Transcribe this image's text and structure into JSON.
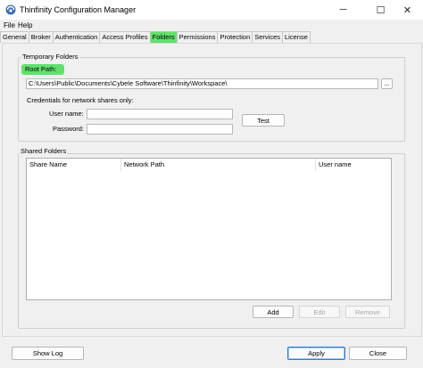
{
  "window": {
    "title": "Thinfinity Configuration Manager",
    "controls": {
      "minimize": "─",
      "maximize": "☐",
      "close": "✕"
    }
  },
  "menu": [
    "File",
    "Help"
  ],
  "tabs": [
    {
      "label": "General"
    },
    {
      "label": "Broker"
    },
    {
      "label": "Authentication"
    },
    {
      "label": "Access Profiles"
    },
    {
      "label": "Folders",
      "active": true
    },
    {
      "label": "Permissions"
    },
    {
      "label": "Protection"
    },
    {
      "label": "Services"
    },
    {
      "label": "License"
    }
  ],
  "temporary_folders": {
    "group_label": "Temporary Folders",
    "root_path_label": "Root Path:",
    "root_path_value": "C:\\Users\\Public\\Documents\\Cybele Software\\Thinfinity\\Workspace\\",
    "browse_label": "...",
    "credentials_label": "Credentials for network shares only:",
    "username_label": "User name:",
    "username_value": "",
    "password_label": "Password:",
    "password_value": "",
    "test_label": "Test"
  },
  "shared_folders": {
    "group_label": "Shared Folders",
    "columns": [
      "Share Name",
      "Network Path",
      "User name"
    ],
    "rows": [],
    "add_label": "Add",
    "edit_label": "Edit",
    "remove_label": "Remove"
  },
  "footer": {
    "show_log_label": "Show Log",
    "apply_label": "Apply",
    "close_label": "Close"
  },
  "colors": {
    "highlight": "#62e06c",
    "primary_border": "#2e7bd6"
  }
}
